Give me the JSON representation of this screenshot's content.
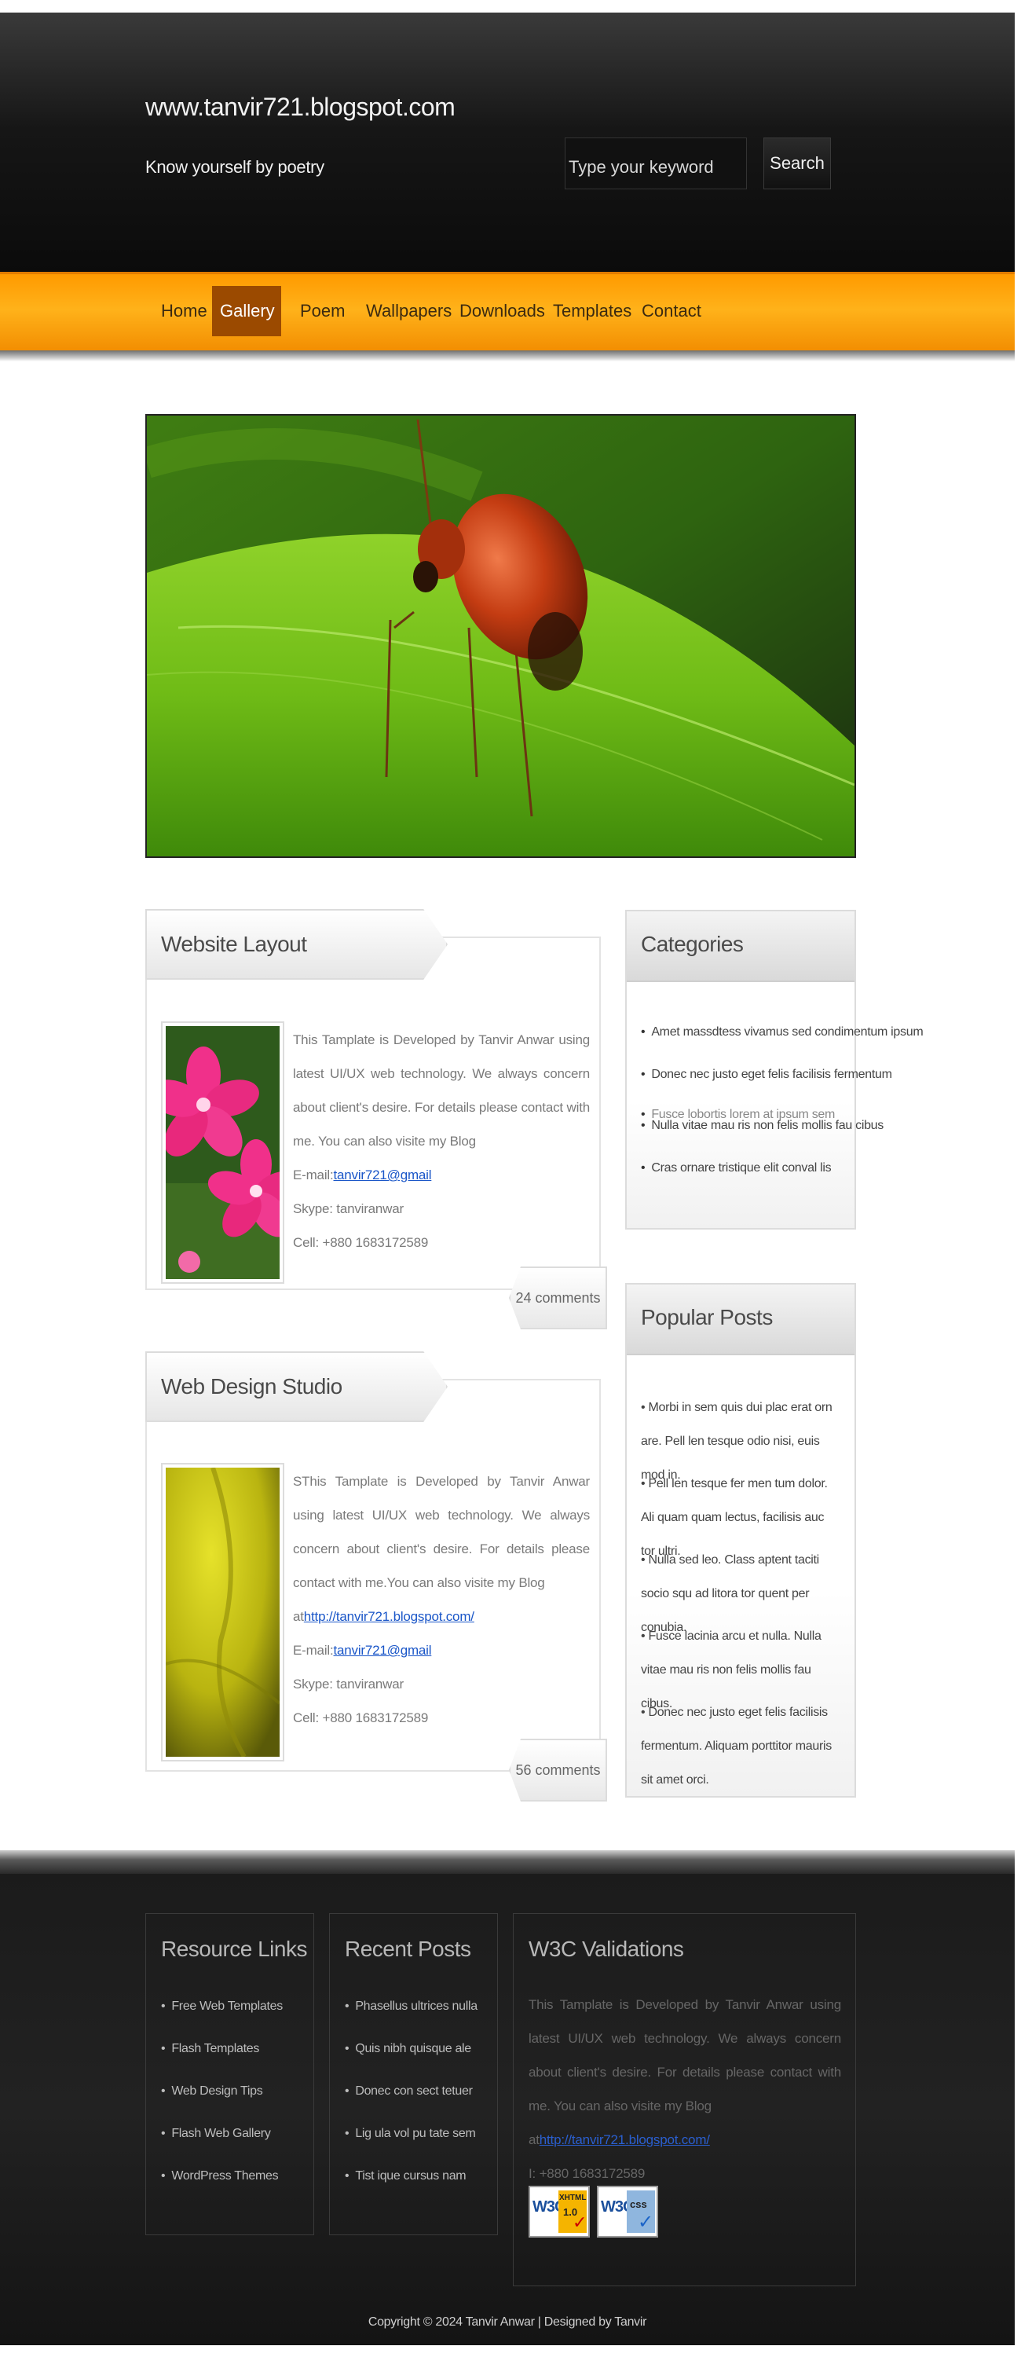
{
  "header": {
    "site_title": "www.tanvir721.blogspot.com",
    "tagline": "Know yourself by poetry",
    "search_placeholder": "Type your keyword",
    "search_button": "Search"
  },
  "nav": {
    "items": [
      "Home",
      "Gallery",
      "Poem",
      "Wallpapers",
      "Downloads",
      "Templates",
      "Contact"
    ],
    "active": "Gallery"
  },
  "posts": [
    {
      "title": "Website Layout",
      "text": "This Tamplate is Developed by Tanvir Anwar using latest UI/UX web technology. We always concern about client's desire. For details please contact with me. You can also visite my Blog",
      "email_label": "E-mail:",
      "email_link": "tanvir721@gmail",
      "skype": "Skype: tanviranwar",
      "cell": "Cell: +880 1683172589",
      "comments": "24 comments"
    },
    {
      "title": "Web Design Studio",
      "text": "SThis Tamplate is Developed by Tanvir Anwar using latest UI/UX web technology. We always concern about client's desire. For details please contact with me.You can also visite my Blog",
      "blog_prefix": "at",
      "blog_link": "http://tanvir721.blogspot.com/",
      "email_label": "E-mail:",
      "email_link": "tanvir721@gmail",
      "skype": "Skype: tanviranwar",
      "cell": "Cell: +880 1683172589",
      "comments": "56 comments"
    }
  ],
  "categories": {
    "title": "Categories",
    "items": [
      "Amet massdtess vivamus sed condimentum ipsum",
      "Donec nec justo eget felis facilisis fermentum",
      "Fusce lobortis lorem at ipsum sem",
      "Nulla vitae mau ris non felis mollis fau cibus",
      "Cras ornare tristique elit conval lis"
    ]
  },
  "popular": {
    "title": "Popular Posts",
    "items": [
      "Morbi in sem quis dui plac erat orn are. Pell len tesque odio nisi, euis mod in.",
      "Pell len tesque fer men tum dolor. Ali quam quam lectus, facilisis auc tor ultri.",
      "Nulla sed leo. Class aptent taciti socio squ ad litora tor quent per conubia.",
      "Fusce lacinia arcu et nulla. Nulla vitae mau ris non felis mollis fau cibus.",
      "Donec nec justo eget felis facilisis fermentum. Aliquam porttitor mauris sit amet orci."
    ]
  },
  "footer": {
    "resource_title": "Resource Links",
    "resource_items": [
      "Free Web Templates",
      "Flash Templates",
      "Web Design Tips",
      "Flash Web Gallery",
      "WordPress Themes"
    ],
    "recent_title": "Recent Posts",
    "recent_items": [
      "Phasellus ultrices nulla",
      "Quis nibh quisque ale",
      "Donec con sect tetuer",
      "Lig ula vol pu tate sem",
      "Tist ique cursus nam"
    ],
    "w3c_title": "W3C Validations",
    "w3c_text": "This Tamplate is Developed by Tanvir Anwar using latest UI/UX web technology. We always concern about client's desire. For details please contact with me. You can also visite my Blog",
    "w3c_prefix": "at",
    "w3c_link": "http://tanvir721.blogspot.com/",
    "w3c_phone": "I: +880 1683172589",
    "badge_xhtml": [
      "W3C",
      "XHTML",
      "1.0"
    ],
    "badge_css": [
      "W3C",
      "css"
    ],
    "copyright": "Copyright © 2024 Tanvir Anwar | Designed by Tanvir"
  },
  "colors": {
    "accent_orange": "#ff9a00",
    "nav_active": "#9b4a00",
    "link_blue": "#1a56c8",
    "header_dark": "#161616"
  }
}
